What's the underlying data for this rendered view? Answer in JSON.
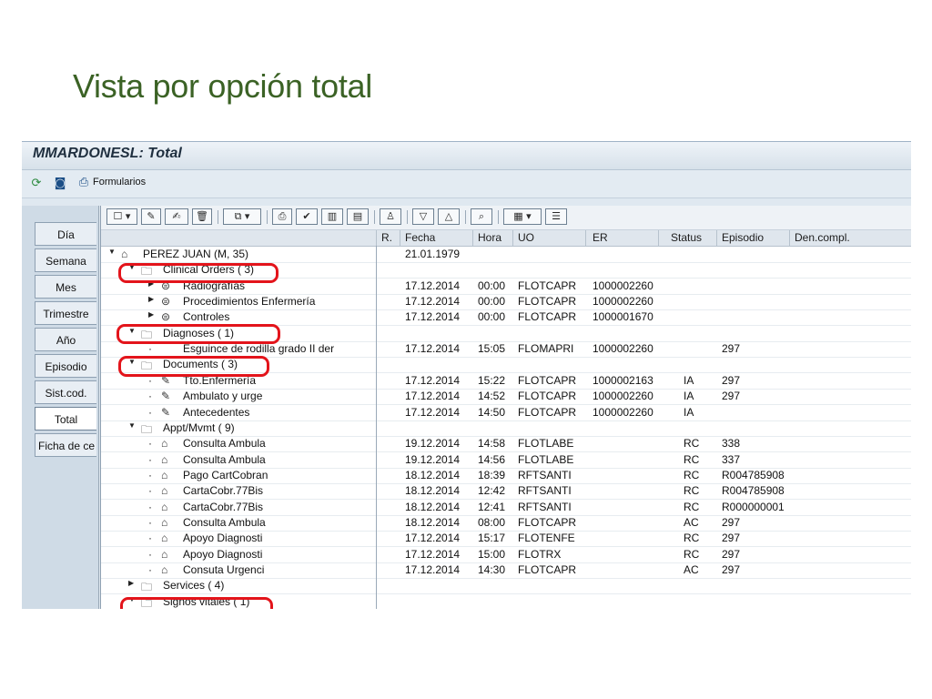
{
  "slide": {
    "title": "Vista por opción total"
  },
  "window": {
    "title": "MMARDONESL: Total"
  },
  "app_toolbar": {
    "formularios_label": "Formularios"
  },
  "tabs": [
    {
      "label": "Día"
    },
    {
      "label": "Semana"
    },
    {
      "label": "Mes"
    },
    {
      "label": "Trimestre"
    },
    {
      "label": "Año"
    },
    {
      "label": "Episodio"
    },
    {
      "label": "Sist.cod."
    },
    {
      "label": "Total"
    },
    {
      "label": "Ficha de ce"
    }
  ],
  "columns": {
    "r": "R.",
    "fecha": "Fecha",
    "hora": "Hora",
    "uo": "UO",
    "er": "ER",
    "status": "Status",
    "episodio": "Episodio",
    "den": "Den.compl."
  },
  "rows": [
    {
      "name": "PEREZ JUAN (M, 35)",
      "fecha": "21.01.1979",
      "hora": "",
      "uo": "",
      "er": "",
      "status": "",
      "episodio": ""
    },
    {
      "name": "Clinical Orders (  3)",
      "fecha": "",
      "hora": "",
      "uo": "",
      "er": "",
      "status": "",
      "episodio": ""
    },
    {
      "name": "Radiografías",
      "fecha": "17.12.2014",
      "hora": "00:00",
      "uo": "FLOTCAPR",
      "er": "1000002260",
      "status": "",
      "episodio": ""
    },
    {
      "name": "Procedimientos Enfermería",
      "fecha": "17.12.2014",
      "hora": "00:00",
      "uo": "FLOTCAPR",
      "er": "1000002260",
      "status": "",
      "episodio": ""
    },
    {
      "name": "Controles",
      "fecha": "17.12.2014",
      "hora": "00:00",
      "uo": "FLOTCAPR",
      "er": "1000001670",
      "status": "",
      "episodio": ""
    },
    {
      "name": "Diagnoses (  1)",
      "fecha": "",
      "hora": "",
      "uo": "",
      "er": "",
      "status": "",
      "episodio": ""
    },
    {
      "name": "Esguince de rodilla grado II der",
      "fecha": "17.12.2014",
      "hora": "15:05",
      "uo": "FLOMAPRI",
      "er": "1000002260",
      "status": "",
      "episodio": "297"
    },
    {
      "name": "Documents (  3)",
      "fecha": "",
      "hora": "",
      "uo": "",
      "er": "",
      "status": "",
      "episodio": ""
    },
    {
      "name": "Tto.Enfermería",
      "fecha": "17.12.2014",
      "hora": "15:22",
      "uo": "FLOTCAPR",
      "er": "1000002163",
      "status": "IA",
      "episodio": "297"
    },
    {
      "name": "Ambulato y urge",
      "fecha": "17.12.2014",
      "hora": "14:52",
      "uo": "FLOTCAPR",
      "er": "1000002260",
      "status": "IA",
      "episodio": "297"
    },
    {
      "name": "Antecedentes",
      "fecha": "17.12.2014",
      "hora": "14:50",
      "uo": "FLOTCAPR",
      "er": "1000002260",
      "status": "IA",
      "episodio": ""
    },
    {
      "name": "Appt/Mvmt (  9)",
      "fecha": "",
      "hora": "",
      "uo": "",
      "er": "",
      "status": "",
      "episodio": ""
    },
    {
      "name": "Consulta Ambula",
      "fecha": "19.12.2014",
      "hora": "14:58",
      "uo": "FLOTLABE",
      "er": "",
      "status": "RC",
      "episodio": "338"
    },
    {
      "name": "Consulta Ambula",
      "fecha": "19.12.2014",
      "hora": "14:56",
      "uo": "FLOTLABE",
      "er": "",
      "status": "RC",
      "episodio": "337"
    },
    {
      "name": "Pago CartCobran",
      "fecha": "18.12.2014",
      "hora": "18:39",
      "uo": "RFTSANTI",
      "er": "",
      "status": "RC",
      "episodio": "R004785908"
    },
    {
      "name": "CartaCobr.77Bis",
      "fecha": "18.12.2014",
      "hora": "12:42",
      "uo": "RFTSANTI",
      "er": "",
      "status": "RC",
      "episodio": "R004785908"
    },
    {
      "name": "CartaCobr.77Bis",
      "fecha": "18.12.2014",
      "hora": "12:41",
      "uo": "RFTSANTI",
      "er": "",
      "status": "RC",
      "episodio": "R000000001"
    },
    {
      "name": "Consulta Ambula",
      "fecha": "18.12.2014",
      "hora": "08:00",
      "uo": "FLOTCAPR",
      "er": "",
      "status": "AC",
      "episodio": "297"
    },
    {
      "name": "Apoyo Diagnosti",
      "fecha": "17.12.2014",
      "hora": "15:17",
      "uo": "FLOTENFE",
      "er": "",
      "status": "RC",
      "episodio": "297"
    },
    {
      "name": "Apoyo Diagnosti",
      "fecha": "17.12.2014",
      "hora": "15:00",
      "uo": "FLOTRX",
      "er": "",
      "status": "RC",
      "episodio": "297"
    },
    {
      "name": "Consuta Urgenci",
      "fecha": "17.12.2014",
      "hora": "14:30",
      "uo": "FLOTCAPR",
      "er": "",
      "status": "AC",
      "episodio": "297"
    },
    {
      "name": "Services (  4)",
      "fecha": "",
      "hora": "",
      "uo": "",
      "er": "",
      "status": "",
      "episodio": ""
    },
    {
      "name": "Signos vitales (  1)",
      "fecha": "",
      "hora": "",
      "uo": "",
      "er": "",
      "status": "",
      "episodio": ""
    }
  ]
}
